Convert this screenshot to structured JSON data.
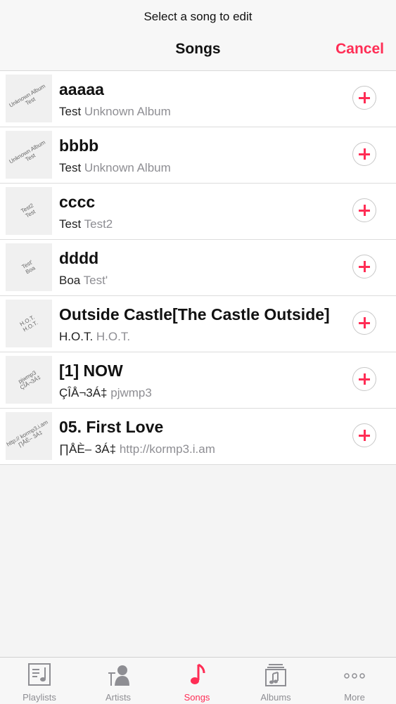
{
  "header": {
    "prompt": "Select a song to edit",
    "title": "Songs",
    "cancel_label": "Cancel"
  },
  "songs": [
    {
      "title": "aaaaa",
      "artist": "Test",
      "album": "Unknown Album",
      "art_line1": "Unknown Album",
      "art_line2": "Test"
    },
    {
      "title": "bbbb",
      "artist": "Test",
      "album": "Unknown Album",
      "art_line1": "Unknown Album",
      "art_line2": "Test"
    },
    {
      "title": "cccc",
      "artist": "Test",
      "album": "Test2",
      "art_line1": "Test2",
      "art_line2": "Test"
    },
    {
      "title": "dddd",
      "artist": "Boa",
      "album": "Test'",
      "art_line1": "Test'",
      "art_line2": "Boa"
    },
    {
      "title": "Outside Castle[The Castle Outside]",
      "artist": "H.O.T.",
      "album": "H.O.T.",
      "art_line1": "H.O.T.",
      "art_line2": "H.O.T."
    },
    {
      "title": "[1] NOW",
      "artist": "ÇÎÅ¬3Á‡",
      "album": "pjwmp3",
      "art_line1": "pjwmp3",
      "art_line2": "ÇÎÅ¬3Á‡"
    },
    {
      "title": "05. First Love",
      "artist": "∏ÅÈ– 3Á‡",
      "album": "http://kormp3.i.am",
      "art_line1": "http:// kormp3.i.am",
      "art_line2": "∏ÅÈ– 3Á‡"
    }
  ],
  "tabs": [
    {
      "label": "Playlists",
      "icon": "playlists-icon"
    },
    {
      "label": "Artists",
      "icon": "artists-icon"
    },
    {
      "label": "Songs",
      "icon": "songs-icon"
    },
    {
      "label": "Albums",
      "icon": "albums-icon"
    },
    {
      "label": "More",
      "icon": "more-icon"
    }
  ],
  "active_tab": "Songs",
  "colors": {
    "accent": "#ff2d55",
    "secondary_text": "#8e8e93"
  }
}
